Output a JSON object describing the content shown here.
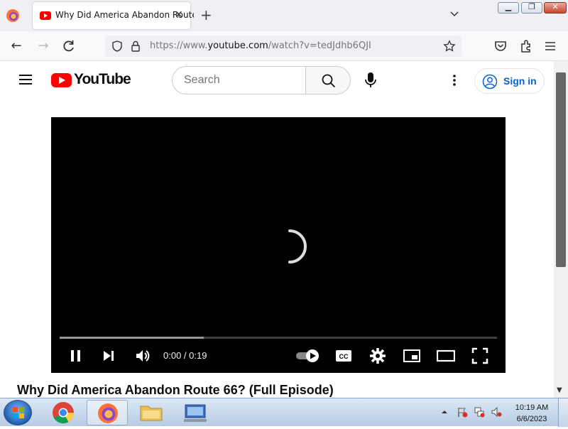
{
  "browser": {
    "tab": {
      "title": "Why Did America Abandon Route 66? (Full Episode)",
      "favicon": "youtube-icon"
    },
    "url": {
      "prefix": "https://www.",
      "domain": "youtube.com",
      "path": "/watch?v=tedJdhb6QJI"
    }
  },
  "youtube": {
    "logo_text": "YouTube",
    "search": {
      "placeholder": "Search"
    },
    "sign_in_label": "Sign in",
    "player": {
      "time_display": "0:00 / 0:19",
      "progress_fraction": 0,
      "buffered_fraction": 0.33,
      "state": "loading"
    },
    "video_title": "Why Did America Abandon Route 66? (Full Episode)"
  },
  "taskbar": {
    "apps": [
      "chrome-icon",
      "firefox-icon",
      "file-explorer-icon",
      "network-computer-icon"
    ],
    "clock": {
      "time": "10:19 AM",
      "date": "6/6/2023"
    }
  },
  "colors": {
    "youtube_red": "#ff0000",
    "link_blue": "#065fd4"
  }
}
